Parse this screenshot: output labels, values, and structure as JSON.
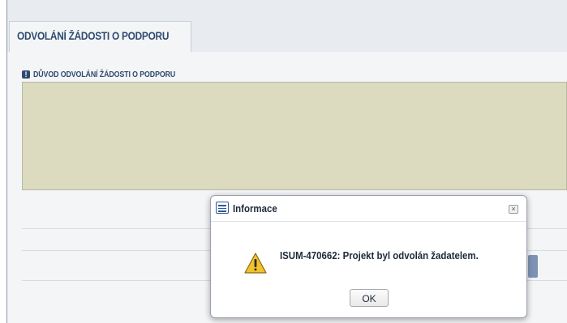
{
  "tabs": [
    {
      "label": "ODVOLÁNÍ ŽÁDOSTI O PODPORU"
    }
  ],
  "form": {
    "required_icon": "required-info-icon",
    "reason_label": "DŮVOD ODVOLÁNÍ ŽÁDOSTI O PODPORU",
    "reason_value": ""
  },
  "dialog": {
    "icon": "window-icon",
    "title": "Informace",
    "close_icon": "close-icon",
    "message_icon": "warning-icon",
    "message": "ISUM-470662: Projekt byl odvolán žadatelem.",
    "ok_label": "OK"
  },
  "colors": {
    "accent": "#2e4a6e",
    "textarea_bg": "#dcdbc0",
    "warning": "#f2c12e"
  }
}
